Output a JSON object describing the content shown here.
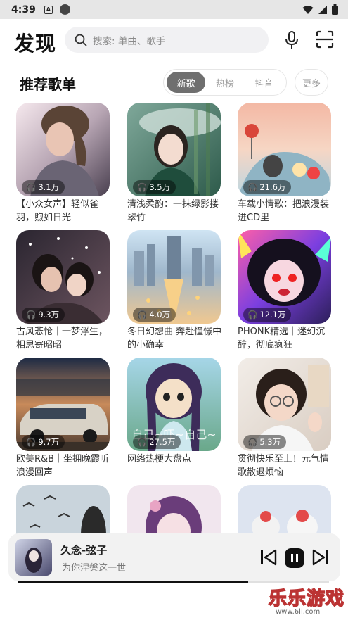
{
  "status_bar": {
    "time": "4:39",
    "app_icon_letter": "A"
  },
  "header": {
    "brand": "发现",
    "search_placeholder": "搜索: 单曲、歌手",
    "icons": [
      "search-icon",
      "microphone-icon",
      "scan-icon"
    ]
  },
  "section": {
    "title": "推荐歌单",
    "tabs": [
      {
        "label": "新歌",
        "active": true
      },
      {
        "label": "热榜",
        "active": false
      },
      {
        "label": "抖音",
        "active": false
      }
    ],
    "more_label": "更多"
  },
  "playlists": [
    {
      "title": "【小众女声】轻似雀羽，煦如日光",
      "plays": "3.1万"
    },
    {
      "title": "清浅柔韵：一抹绿影搂翠竹",
      "plays": "3.5万"
    },
    {
      "title": "车载小情歌：把浪漫装进CD里",
      "plays": "21.6万"
    },
    {
      "title": "古风悲怆｜一梦浮生，相思寄昭昭",
      "plays": "9.3万"
    },
    {
      "title": "冬日幻想曲 奔赴憧憬中的小确幸",
      "plays": "4.0万"
    },
    {
      "title": "PHONK精选｜迷幻沉醉，彻底疯狂",
      "plays": "12.1万"
    },
    {
      "title": "欧美R&B｜坐拥晚霞听浪漫回声",
      "plays": "9.7万"
    },
    {
      "title": "网络热梗大盘点",
      "plays": "27.5万"
    },
    {
      "title": "贯彻快乐至上！元气情歌散退烦恼",
      "plays": "5.3万"
    },
    {
      "title": "",
      "plays": ""
    },
    {
      "title": "",
      "plays": ""
    },
    {
      "title": "",
      "plays": ""
    }
  ],
  "cover_overlay_texts": {
    "playlist_8": "自己~吓~自己~"
  },
  "player": {
    "song": "久念-弦子",
    "lyric": "为你涅槃这一世",
    "progress": 0.74,
    "controls": [
      "previous-icon",
      "pause-icon",
      "next-icon"
    ]
  },
  "watermark": {
    "text": "乐乐游戏",
    "url": "www.6ll.com"
  }
}
